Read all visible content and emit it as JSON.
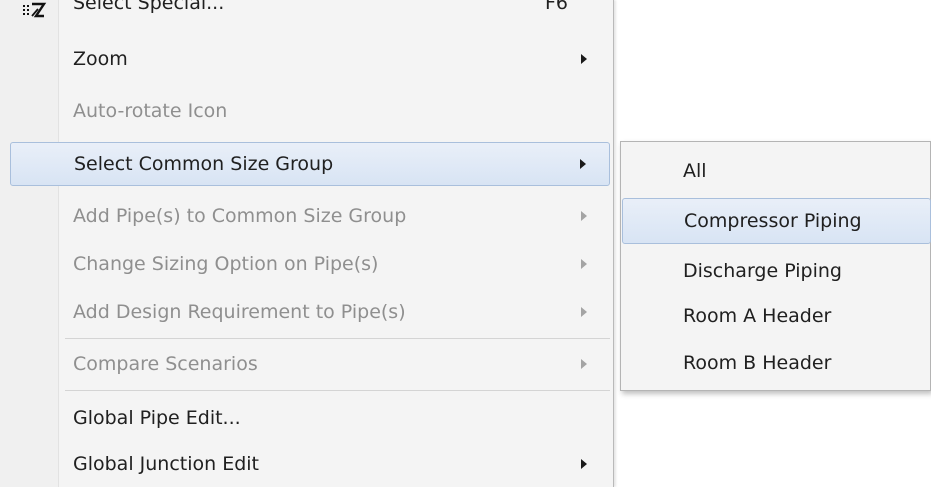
{
  "main_menu": {
    "partial_top": {
      "label": "Select Special...",
      "shortcut": "F6",
      "icon": "select-special-icon"
    },
    "items": [
      {
        "label": "Zoom",
        "disabled": false,
        "submenu": true
      },
      {
        "label": "Auto-rotate Icon",
        "disabled": true,
        "submenu": false
      },
      {
        "label": "Select Common Size Group",
        "disabled": false,
        "submenu": true,
        "highlighted": true
      },
      {
        "label": "Add Pipe(s) to Common Size Group",
        "disabled": true,
        "submenu": true
      },
      {
        "label": "Change Sizing Option on Pipe(s)",
        "disabled": true,
        "submenu": true
      },
      {
        "label": "Add Design Requirement to Pipe(s)",
        "disabled": true,
        "submenu": true
      },
      {
        "label": "Compare Scenarios",
        "disabled": true,
        "submenu": true
      },
      {
        "label": "Global Pipe Edit...",
        "disabled": false,
        "submenu": false
      },
      {
        "label": "Global Junction Edit",
        "disabled": false,
        "submenu": true
      }
    ]
  },
  "submenu": {
    "items": [
      {
        "label": "All",
        "highlighted": false
      },
      {
        "label": "Compressor Piping",
        "highlighted": true
      },
      {
        "label": "Discharge Piping",
        "highlighted": false
      },
      {
        "label": "Room A Header",
        "highlighted": false
      },
      {
        "label": "Room B Header",
        "highlighted": false
      }
    ]
  },
  "colors": {
    "menu_background": "#f4f4f4",
    "highlight_start": "#e9eff8",
    "highlight_end": "#d8e4f4",
    "highlight_border": "#a9bfdc",
    "enabled_text": "#202020",
    "disabled_text": "#8f8f8f"
  }
}
